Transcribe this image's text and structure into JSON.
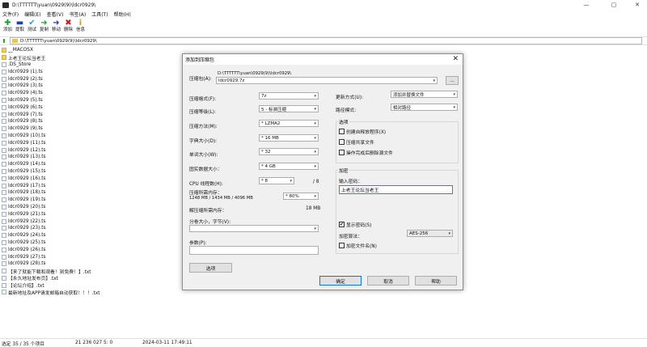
{
  "window": {
    "title": "D:\\TTTTTT\\yuan\\0929(9)\\ldcr0929\\",
    "minimize": "—",
    "maximize": "▢",
    "close": "✕"
  },
  "menu": [
    "文件(F)",
    "编辑(E)",
    "查看(V)",
    "书签(A)",
    "工具(T)",
    "帮助(H)"
  ],
  "toolbar": [
    {
      "label": "添加",
      "icon": "add-icon",
      "glyph": "✚",
      "color": "#1f9b3a"
    },
    {
      "label": "提取",
      "icon": "extract-icon",
      "glyph": "▬",
      "color": "#1c3fb5"
    },
    {
      "label": "测试",
      "icon": "test-icon",
      "glyph": "✔",
      "color": "#2a9fd6"
    },
    {
      "label": "复制",
      "icon": "copy-icon",
      "glyph": "➜",
      "color": "#1f9b3a"
    },
    {
      "label": "移动",
      "icon": "move-icon",
      "glyph": "➜",
      "color": "#1c3fb5"
    },
    {
      "label": "删除",
      "icon": "delete-icon",
      "glyph": "✖",
      "color": "#c8171e"
    },
    {
      "label": "信息",
      "icon": "info-icon",
      "glyph": "i",
      "color": "#c9a200"
    }
  ],
  "address": "D:\\TTTTTT\\yuan\\0929(9)\\ldcr0929\\",
  "files": [
    {
      "name": "__MACOSX",
      "folder": true
    },
    {
      "name": "上老王论坛当老王",
      "folder": true
    },
    {
      "name": ".DS_Store",
      "folder": false
    },
    {
      "name": "ldcr0929 (1).ts",
      "folder": false
    },
    {
      "name": "ldcr0929 (2).ts",
      "folder": false
    },
    {
      "name": "ldcr0929 (3).ts",
      "folder": false
    },
    {
      "name": "ldcr0929 (4).ts",
      "folder": false
    },
    {
      "name": "ldcr0929 (5).ts",
      "folder": false
    },
    {
      "name": "ldcr0929 (6).ts",
      "folder": false
    },
    {
      "name": "ldcr0929 (7).ts",
      "folder": false
    },
    {
      "name": "ldcr0929 (8).ts",
      "folder": false
    },
    {
      "name": "ldcr0929 (9).ts",
      "folder": false
    },
    {
      "name": "ldcr0929 (10).ts",
      "folder": false
    },
    {
      "name": "ldcr0929 (11).ts",
      "folder": false
    },
    {
      "name": "ldcr0929 (12).ts",
      "folder": false
    },
    {
      "name": "ldcr0929 (13).ts",
      "folder": false
    },
    {
      "name": "ldcr0929 (14).ts",
      "folder": false
    },
    {
      "name": "ldcr0929 (15).ts",
      "folder": false
    },
    {
      "name": "ldcr0929 (16).ts",
      "folder": false
    },
    {
      "name": "ldcr0929 (17).ts",
      "folder": false
    },
    {
      "name": "ldcr0929 (18).ts",
      "folder": false
    },
    {
      "name": "ldcr0929 (19).ts",
      "folder": false
    },
    {
      "name": "ldcr0929 (20).ts",
      "folder": false
    },
    {
      "name": "ldcr0929 (21).ts",
      "folder": false
    },
    {
      "name": "ldcr0929 (22).ts",
      "folder": false
    },
    {
      "name": "ldcr0929 (23).ts",
      "folder": false
    },
    {
      "name": "ldcr0929 (24).ts",
      "folder": false
    },
    {
      "name": "ldcr0929 (25).ts",
      "folder": false
    },
    {
      "name": "ldcr0929 (26).ts",
      "folder": false
    },
    {
      "name": "ldcr0929 (27).ts",
      "folder": false
    },
    {
      "name": "ldcr0929 (28).ts",
      "folder": false
    },
    {
      "name": "【来了就能下载和观看！别免费！】.txt",
      "folder": false
    },
    {
      "name": "【永久地址发布页】.txt",
      "folder": false
    },
    {
      "name": "【论坛介绍】.txt",
      "folder": false
    },
    {
      "name": "最新地址及APP请发邮箱自动获取！！！.txt",
      "folder": false
    }
  ],
  "status": {
    "selection": "选定 35 / 35 个项目",
    "size": "21 236 027 5: 0",
    "date": "2024-03-11 17:49:11"
  },
  "dialog": {
    "title": "添加到压缩包",
    "close": "✕",
    "archive_label": "压缩包(A):",
    "archive_path": "D:\\TTTTTT\\yuan\\0929(9)\\ldcr0929\\",
    "archive_name": "ldcr0929.7z",
    "browse": "...",
    "format_label": "压缩格式(F):",
    "format_value": "7z",
    "level_label": "压缩等级(L):",
    "level_value": "5 - 标准压缩",
    "method_label": "压缩方法(M):",
    "method_value": "* LZMA2",
    "dict_label": "字典大小(D):",
    "dict_value": "* 16 MB",
    "word_label": "单词大小(W):",
    "word_value": "* 32",
    "solid_label": "固实数据大小：",
    "solid_value": "* 4 GB",
    "threads_label": "CPU 线程数(H):",
    "threads_value": "* 8",
    "threads_max": "/ 8",
    "memory_label": "压缩所需内存：",
    "memory_detail": "1248 MB / 1434 MB / 4096 MB",
    "memory_value": "* 80%",
    "decompress_label": "解压缩所需内存：",
    "decompress_value": "18 MB",
    "split_label": "分卷大小，字节(V):",
    "split_value": "",
    "params_label": "参数(P):",
    "params_value": "",
    "options_button": "选项",
    "update_label": "更新方式(U):",
    "update_value": "添加并替换文件",
    "pathmode_label": "路径模式:",
    "pathmode_value": "相对路径",
    "options_group": "选项",
    "opt_sfx": "创建自释放程序(X)",
    "opt_shared": "压缩共享文件",
    "opt_delete": "操作完成后删除源文件",
    "encrypt_group": "加密",
    "password_label": "输入密码：",
    "password_value": "上老王论坛当老王",
    "show_password": "显示密码(S)",
    "show_password_checked": "✔",
    "enc_method_label": "加密算法：",
    "enc_method_value": "AES-256",
    "encrypt_names": "加密文件名(N)",
    "ok": "确定",
    "cancel": "取消",
    "help": "帮助"
  }
}
